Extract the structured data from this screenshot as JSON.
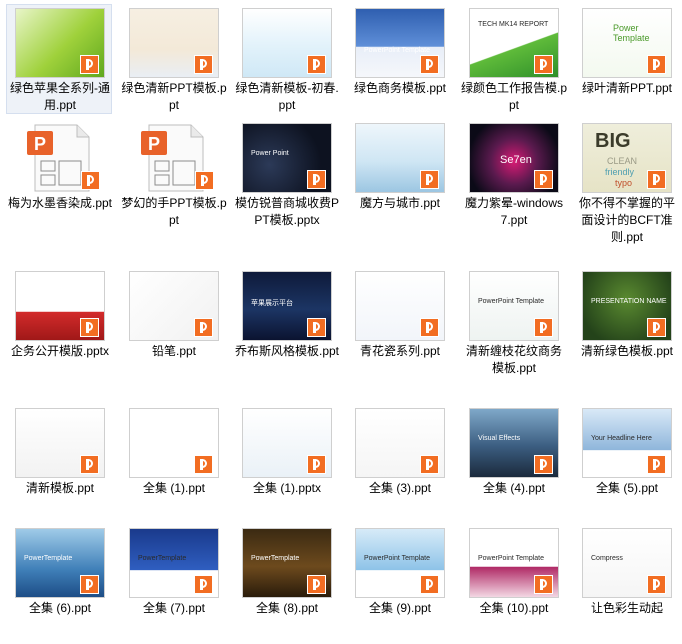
{
  "files": [
    {
      "id": "t1",
      "label": "绿色苹果全系列-通用.ppt",
      "style": "apple",
      "selected": true
    },
    {
      "id": "t2",
      "label": "绿色清新PPT模板.ppt",
      "style": "pastel"
    },
    {
      "id": "t3",
      "label": "绿色清新模板-初春.ppt",
      "style": "leafblue"
    },
    {
      "id": "t4",
      "label": "绿色商务模板.ppt",
      "style": "pptblue",
      "text": "PowerPoint Template"
    },
    {
      "id": "t5",
      "label": "绿颜色工作报告模.ppt",
      "style": "greenreport",
      "text": "TECH MK14 REPORT"
    },
    {
      "id": "t6",
      "label": "绿叶清新PPT.ppt",
      "style": "greenleaf",
      "text": "Power Template"
    },
    {
      "id": "t7",
      "label": "梅为水墨香染成.ppt",
      "style": "generic"
    },
    {
      "id": "t8",
      "label": "梦幻的手PPT模板.ppt",
      "style": "generic"
    },
    {
      "id": "t9",
      "label": "模仿锐普商城收费PPT模板.pptx",
      "style": "circles",
      "text": "Power Point"
    },
    {
      "id": "t10",
      "label": "魔方与城市.ppt",
      "style": "city"
    },
    {
      "id": "t11",
      "label": "魔力紫晕-windows7.ppt",
      "style": "win7",
      "text": "Se7en"
    },
    {
      "id": "t12",
      "label": "你不得不掌握的平面设计的BCFT准则.ppt",
      "style": "big",
      "text": "BIG",
      "text2": "CLEAN",
      "text3": "friendly",
      "text4": "typo"
    },
    {
      "id": "t13",
      "label": "企务公开模版.pptx",
      "style": "redwave"
    },
    {
      "id": "t14",
      "label": "铅笔.ppt",
      "style": "pencil"
    },
    {
      "id": "t15",
      "label": "乔布斯风格模板.ppt",
      "style": "jobs",
      "text": "苹果展示平台"
    },
    {
      "id": "t16",
      "label": "青花瓷系列.ppt",
      "style": "qinghua"
    },
    {
      "id": "t17",
      "label": "清新缠枝花纹商务模板.ppt",
      "style": "floral",
      "text": "PowerPoint Template"
    },
    {
      "id": "t18",
      "label": "清新绿色模板.ppt",
      "style": "darkgreen",
      "text": "PRESENTATION NAME"
    },
    {
      "id": "t19",
      "label": "清新模板.ppt",
      "style": "globe"
    },
    {
      "id": "t20",
      "label": "全集 (1).ppt",
      "style": "whitecorner"
    },
    {
      "id": "t21",
      "label": "全集 (1).pptx",
      "style": "bluearrow"
    },
    {
      "id": "t22",
      "label": "全集 (3).ppt",
      "style": "cubes"
    },
    {
      "id": "t23",
      "label": "全集 (4).ppt",
      "style": "mountain",
      "text": "Visual Effects"
    },
    {
      "id": "t24",
      "label": "全集 (5).ppt",
      "style": "bluebuild",
      "text": "Your Headline Here"
    },
    {
      "id": "t25",
      "label": "全集 (6).ppt",
      "style": "island",
      "text": "PowerTemplate"
    },
    {
      "id": "t26",
      "label": "全集 (7).ppt",
      "style": "gift",
      "text": "PowerTemplate"
    },
    {
      "id": "t27",
      "label": "全集 (8).ppt",
      "style": "temple",
      "text": "PowerTemplate"
    },
    {
      "id": "t28",
      "label": "全集 (9).ppt",
      "style": "skyblue",
      "text": "PowerPoint Template"
    },
    {
      "id": "t29",
      "label": "全集 (10).ppt",
      "style": "pinkwave",
      "text": "PowerPoint Template"
    },
    {
      "id": "t30",
      "label": "让色彩生动起",
      "style": "compress",
      "text": "Compress"
    }
  ]
}
